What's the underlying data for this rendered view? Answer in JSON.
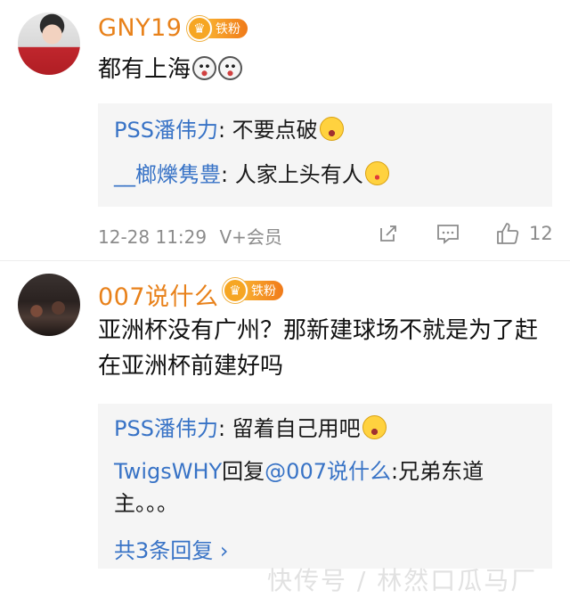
{
  "comments": [
    {
      "username": "GNY19",
      "fan_badge": "铁粉",
      "text": "都有上海",
      "replies": [
        {
          "user": "PSS潘伟力",
          "sep": ": ",
          "text": "不要点破"
        },
        {
          "user": "__榔爍隽豊",
          "sep": ": ",
          "text": "人家上头有人"
        }
      ],
      "time": "12-28 11:29",
      "source": "V+会员",
      "like_count": "12"
    },
    {
      "username": "007说什么",
      "fan_badge": "铁粉",
      "text": "亚洲杯没有广州？那新建球场不就是为了赶在亚洲杯前建好吗",
      "replies": [
        {
          "user": "PSS潘伟力",
          "sep": ": ",
          "text": "留着自己用吧"
        },
        {
          "user": "TwigsWHY",
          "sep": "回复",
          "mention": "@007说什么",
          "text": ":兄弟东道主。。。"
        }
      ],
      "more_replies": "共3条回复 ›"
    }
  ],
  "watermark": "快传号 / 林然口瓜马厂",
  "icons": {
    "share": "share-icon",
    "comment": "comment-icon",
    "like": "like-icon",
    "crown": "crown-icon"
  },
  "colors": {
    "username": "#e8811a",
    "reply_user": "#3873c6",
    "meta": "#8c8c8c"
  }
}
